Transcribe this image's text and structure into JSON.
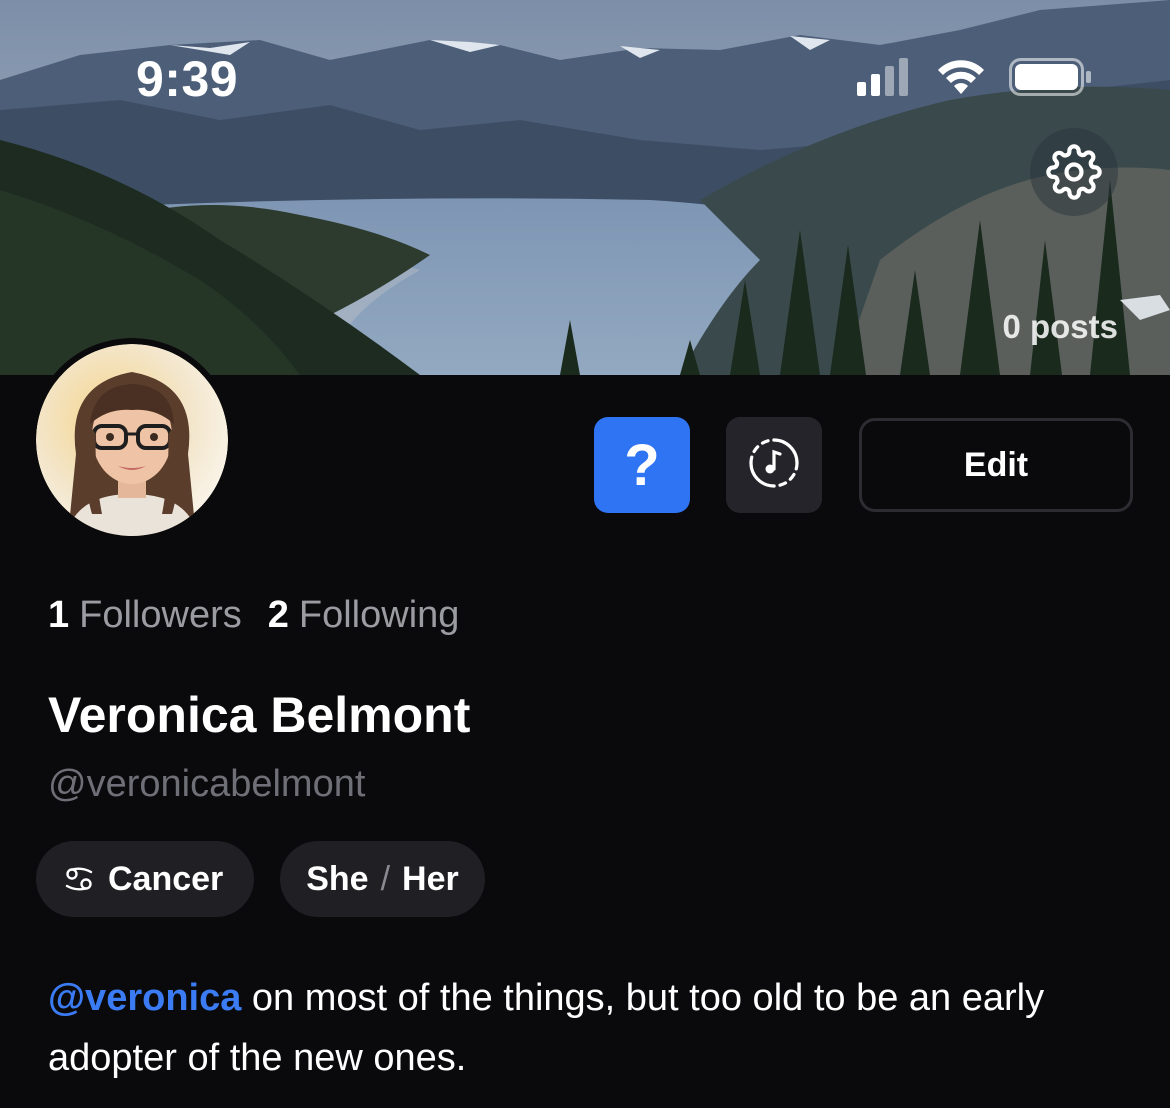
{
  "status_bar": {
    "time": "9:39",
    "signal_icon": "cellular-signal-icon",
    "wifi_icon": "wifi-icon",
    "battery_icon": "battery-icon"
  },
  "header": {
    "banner_image": "mountain-lake-landscape",
    "settings_icon": "gear-icon",
    "posts_count": "0 posts"
  },
  "profile": {
    "avatar": "illustrated-avatar",
    "actions": {
      "help_label": "?",
      "music_icon": "music-note-icon",
      "edit_label": "Edit"
    },
    "stats": {
      "followers_count": "1",
      "followers_label": "Followers",
      "following_count": "2",
      "following_label": "Following"
    },
    "display_name": "Veronica Belmont",
    "handle": "@veronicabelmont",
    "chips": {
      "zodiac_icon": "cancer-zodiac-icon",
      "zodiac": "Cancer",
      "pronoun_subject": "She",
      "pronoun_separator": "/",
      "pronoun_object": "Her"
    },
    "bio": {
      "mention": "@veronica",
      "text": " on most of the things, but too old to be an early adopter of the new ones."
    }
  },
  "colors": {
    "background": "#0a0a0c",
    "accent": "#2f74f3",
    "mention": "#3b7cf5",
    "muted": "#9b9ba2",
    "chip": "#1f1f24"
  }
}
